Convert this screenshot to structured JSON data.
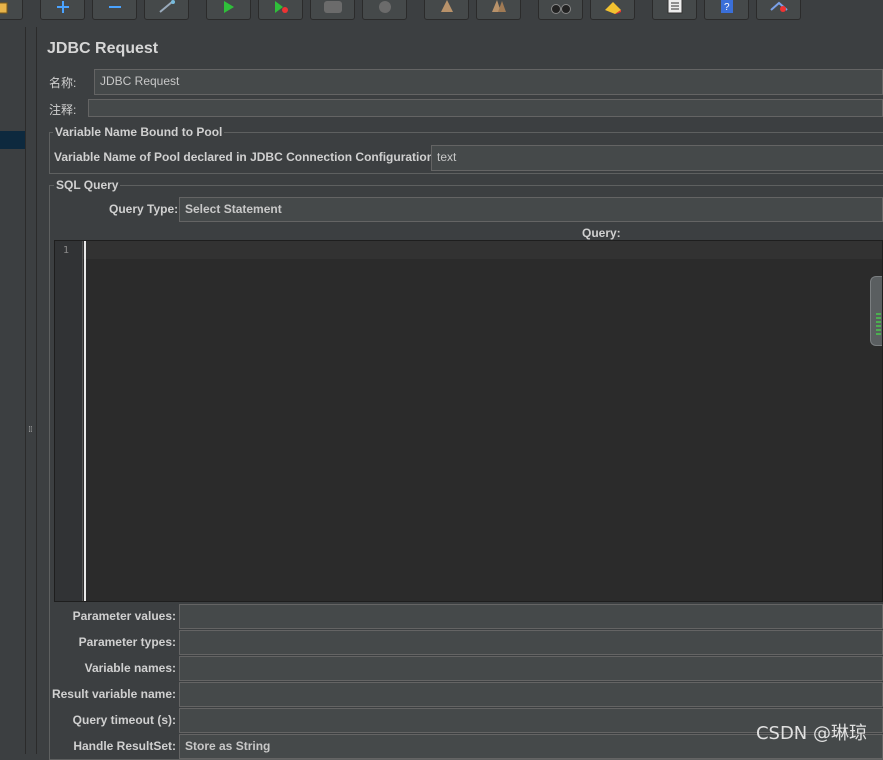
{
  "toolbar": {
    "buttons": [
      {
        "name": "open-button",
        "icon": "open-icon"
      },
      {
        "name": "expand-button",
        "icon": "plus-icon"
      },
      {
        "name": "collapse-button",
        "icon": "minus-icon"
      },
      {
        "name": "toggle-button",
        "icon": "wand-icon"
      },
      {
        "name": "start-button",
        "icon": "play-icon"
      },
      {
        "name": "start-no-pause-button",
        "icon": "play-nopause-icon"
      },
      {
        "name": "stop-button",
        "icon": "stop-icon"
      },
      {
        "name": "shutdown-button",
        "icon": "shutdown-icon"
      },
      {
        "name": "clear-button",
        "icon": "broom-icon"
      },
      {
        "name": "clear-all-button",
        "icon": "broom-all-icon"
      },
      {
        "name": "search-button",
        "icon": "binoculars-icon"
      },
      {
        "name": "reset-search-button",
        "icon": "eraser-icon"
      },
      {
        "name": "function-helper-button",
        "icon": "list-icon"
      },
      {
        "name": "help-button",
        "icon": "help-icon"
      },
      {
        "name": "remote-button",
        "icon": "remote-icon"
      }
    ]
  },
  "panel": {
    "title": "JDBC Request",
    "name_label": "名称:",
    "name_value": "JDBC Request",
    "comment_label": "注释:",
    "comment_value": ""
  },
  "pool_group": {
    "title": "Variable Name Bound to Pool",
    "pool_label": "Variable Name of Pool declared in JDBC Connection Configuration:",
    "pool_value": "text"
  },
  "sql_group": {
    "title": "SQL Query",
    "query_type_label": "Query Type:",
    "query_type_value": "Select Statement",
    "query_label": "Query:",
    "line_number": "1"
  },
  "params": [
    {
      "label": "Parameter values:",
      "value": ""
    },
    {
      "label": "Parameter types:",
      "value": ""
    },
    {
      "label": "Variable names:",
      "value": ""
    },
    {
      "label": "Result variable name:",
      "value": ""
    },
    {
      "label": "Query timeout (s):",
      "value": ""
    },
    {
      "label": "Handle ResultSet:",
      "value": "Store as String"
    }
  ],
  "watermark": "CSDN @琳琼",
  "colors": {
    "background": "#3c3f41",
    "field": "#45494a",
    "editor": "#2b2b2b",
    "selection": "#0d293e"
  }
}
